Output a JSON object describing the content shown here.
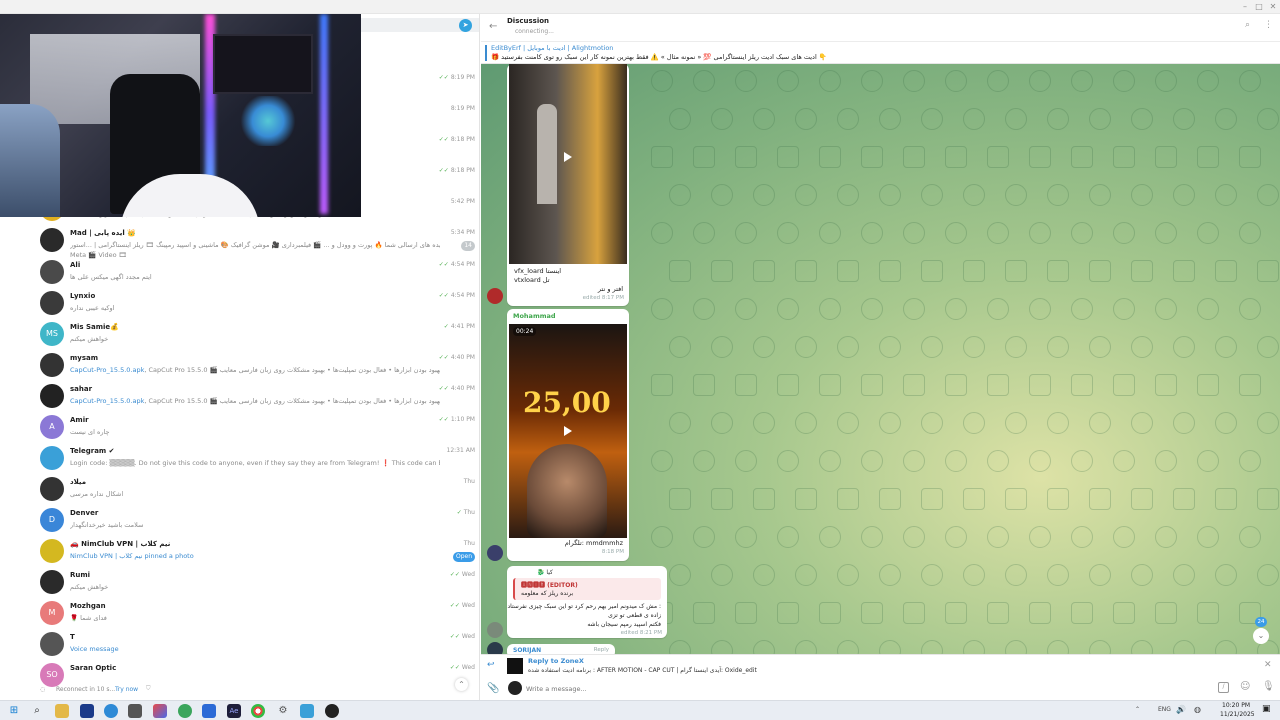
{
  "window": {
    "min": "–",
    "max": "□",
    "close": "✕"
  },
  "chat_list": {
    "rows": [
      {
        "name": "",
        "preview": "",
        "time": "8:19 PM",
        "check": "✓✓"
      },
      {
        "name": "",
        "preview": "",
        "time": "8:19 PM",
        "check": ""
      },
      {
        "name": "",
        "preview": "",
        "time": "8:18 PM",
        "check": "✓✓"
      },
      {
        "name": "",
        "preview": "",
        "time": "8:18 PM",
        "check": "✓✓"
      },
      {
        "name": "",
        "preview": "لوکیشن قس و گاس به دلیل افت کیفیت به ربتی جدید فلو دینا منتقل شد | #اخبار و اطلاعیه ها",
        "time": "5:42 PM",
        "check": ""
      },
      {
        "name": "Mad | ایده پابی 👑",
        "preview": "ایده های ارسالی شما 🔥 پورت و وودل و ... 🎬 فیلمبرداری 🎥 موشن گرافیک 🎨 ماشینی و اسپید رمپینگ 🎞 ریلز اینستاگرامی | ...استور",
        "preview2": "Meta 🎬 Video 🎞",
        "time": "5:34 PM",
        "check": "",
        "badge": "14"
      },
      {
        "name": "Ali",
        "preview": "ایتم مجدد اگهی میکس علی ها",
        "time": "4:54 PM",
        "check": "✓✓"
      },
      {
        "name": "Lynxio",
        "preview": "اوکیه عیبی نداره",
        "time": "4:54 PM",
        "check": "✓✓"
      },
      {
        "name": "Mis Samie💰",
        "preview": "خواهش میکنم",
        "time": "4:41 PM",
        "check": "✓",
        "avatar": "MS"
      },
      {
        "name": "mysam",
        "preview_blue": "CapCut-Pro_15.5.0.apk",
        "preview": ", CapCut Pro 15.5.0 🎬 مزایای این نسخه: • بهبود بودن ابزارها • فعال بودن تمپلیت‌ها • بهبود مشکلات روی زبان فارسی  معایب : ...",
        "time": "4:40 PM",
        "check": "✓✓"
      },
      {
        "name": "sahar",
        "preview_blue": "CapCut-Pro_15.5.0.apk",
        "preview": ", CapCut Pro 15.5.0 🎬 مزایای این نسخه: • بهبود بودن ابزارها • فعال بودن تمپلیت‌ها • بهبود مشکلات روی زبان فارسی  معایب : ...",
        "time": "4:40 PM",
        "check": "✓✓"
      },
      {
        "name": "Amir",
        "preview": "چاره ای نیست",
        "time": "1:10 PM",
        "check": "✓✓",
        "avatar": "A"
      },
      {
        "name": "Telegram ✔",
        "preview": "Login code: ▒▒▒▒▒. Do not give this code to anyone, even if they say they are from Telegram!  ❗ This code can be used to log in to your ...",
        "time": "12:31 AM",
        "check": ""
      },
      {
        "name": "میلاد",
        "preview": "اشکال نداره مرسی",
        "time": "Thu",
        "check": ""
      },
      {
        "name": "Denver",
        "preview": "سلامت باشید  خیرخدانگهدار",
        "time": "Thu",
        "check": "✓",
        "avatar": "D"
      },
      {
        "name": "🚗 NimClub VPN | نیم کلاب",
        "preview_blue": "NimClub VPN | نیم کلاب pinned a photo",
        "preview": "",
        "time": "Thu",
        "check": "",
        "badge": "Open"
      },
      {
        "name": "Rumi",
        "preview": "خواهش میکنم",
        "time": "Wed",
        "check": "✓✓"
      },
      {
        "name": "Mozhgan",
        "preview": "🌹 فدای شما",
        "time": "Wed",
        "check": "✓✓",
        "avatar": "M"
      },
      {
        "name": "T",
        "preview_blue": "Voice message",
        "preview": "",
        "time": "Wed",
        "check": "✓✓"
      },
      {
        "name": "Saran Optic",
        "preview": "",
        "time": "Wed",
        "check": "✓✓",
        "avatar": "SO"
      }
    ],
    "status_text": "Reconnect in 10 s...",
    "try_now": "Try now",
    "up": "⌃"
  },
  "chat": {
    "title": "Discussion",
    "status": "connecting...",
    "pin_title": "EditByErf | ادیت با موبایل | Alightmotion",
    "pin_text": "🎁 ادیت های سبک ادیت ریلز اینستاگرامی 💯 « نمونه مثال » ⚠️ فقط بهترین نمونه کار این سبک رو توی کامنت بفرستید 👇",
    "msg1_text1": "vfx_loard اینستا",
    "msg1_text2": "vtxloard تل",
    "msg1_text3": "افتر و نتر",
    "msg1_time": "edited 8:17 PM",
    "msg2_author": "Mohammad",
    "msg2_duration": "00:24",
    "msg2_overlay": "25,00",
    "msg2_caption": "تلگرام: mmdmmhz",
    "msg2_time": "8:18 PM",
    "msg3_author": "🐉 کیا",
    "msg3_quote_author": "🅰🅽🅸🆁 (EDITOR)",
    "msg3_quote_text": "برنده ریلز که معلومه",
    "msg3_line1": "مش ک میدونم امیر بهم رحم کرد تو این سبک چیزی نفرستاد :",
    "msg3_line2": "زاده ی قطعی تو تزی",
    "msg3_line3": "فکتم اسپید رمپم سیجان باشه",
    "msg3_time": "edited 8:21 PM",
    "msg4_author": "SORIJAN",
    "msg4_reply": "Reply",
    "unread": "24",
    "reply_to": "Reply to ZoneX",
    "reply_text": "برنامه ادیت استفاده شده : AFTER MOTION - CAP CUT | آیدی اینستا گرام: Oxide_edit",
    "input_placeholder": "Write a message..."
  },
  "taskbar": {
    "time": "10:20 PM",
    "date": "11/21/2025",
    "lang": "ENG"
  }
}
